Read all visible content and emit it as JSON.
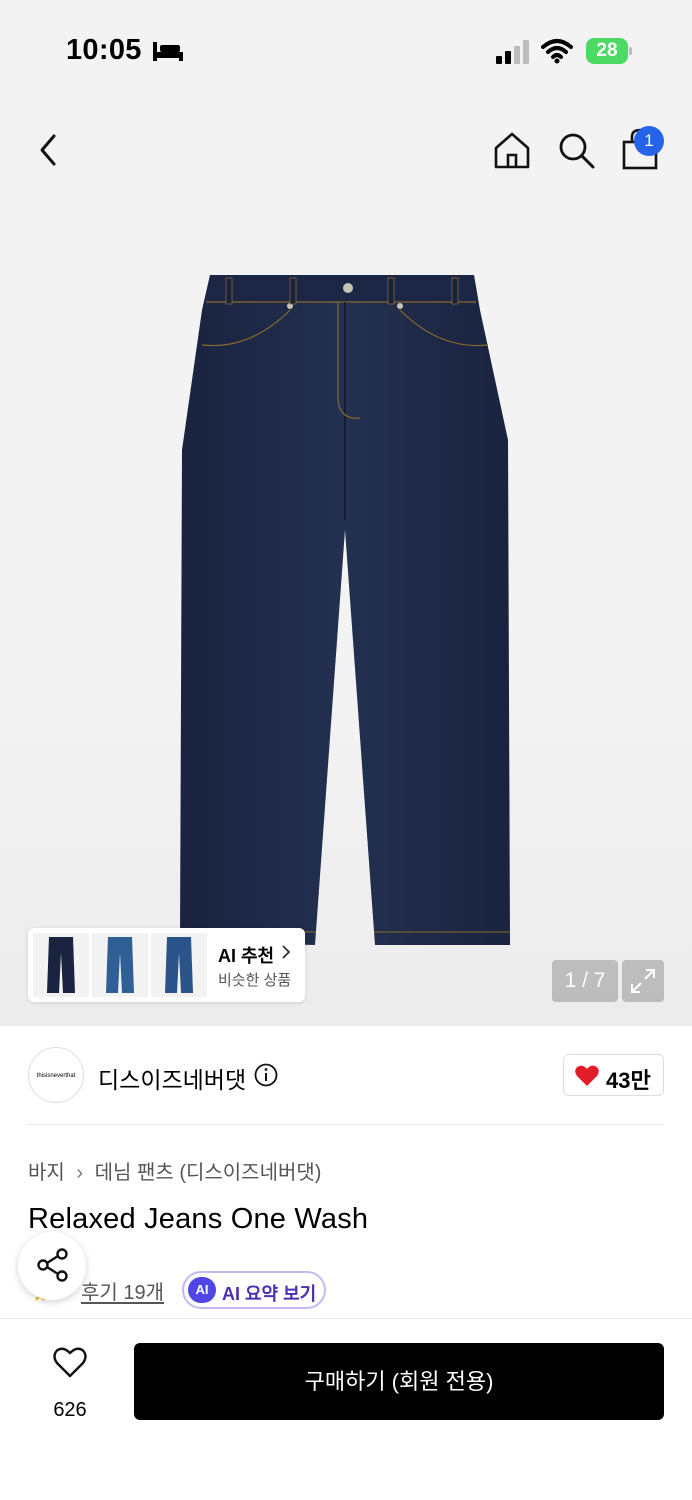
{
  "status_bar": {
    "time": "10:05",
    "battery": "28"
  },
  "gallery": {
    "counter": "1 / 7",
    "ai_recommend": {
      "title": "AI 추천",
      "subtitle": "비슷한 상품"
    }
  },
  "nav": {
    "cart_count": "1"
  },
  "brand": {
    "logo_text": "thisisneverthat",
    "name": "디스이즈네버댓",
    "likes": "43만"
  },
  "breadcrumb": [
    "바지",
    "데님 팬츠 (디스이즈네버댓)"
  ],
  "product": {
    "title": "Relaxed Jeans One Wash",
    "reviews": "후기 19개",
    "ai_summary_badge": "AI",
    "ai_summary_label": "AI 요약 보기"
  },
  "bottom_bar": {
    "wish_count": "626",
    "buy_label": "구매하기 (회원 전용)"
  },
  "colors": {
    "accent": "#2563eb",
    "heart": "#e11d2a",
    "denim": "#1e2a48",
    "buy_button": "#000000"
  }
}
